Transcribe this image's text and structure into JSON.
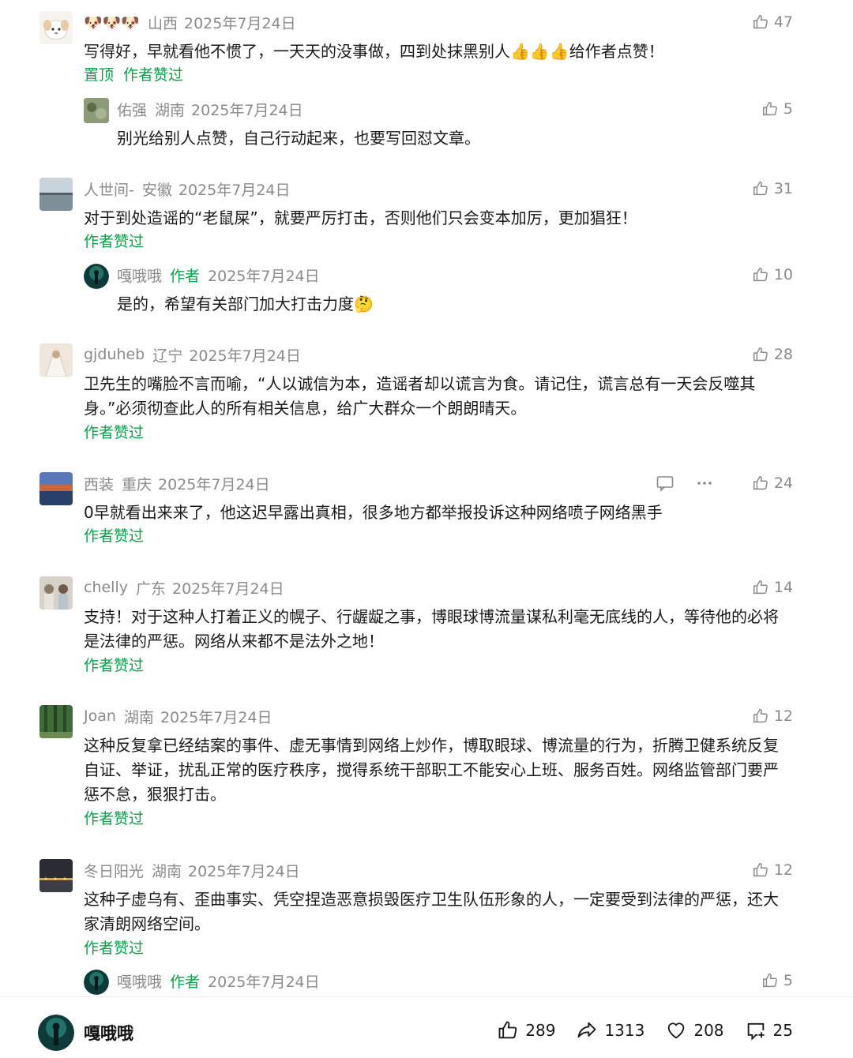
{
  "comments": [
    {
      "nick": "🐶🐶🐶",
      "region": "山西",
      "date": "2025年7月24日",
      "likes": "47",
      "text": "写得好，早就看他不惯了，一天天的没事做，四到处抹黑别人👍👍👍给作者点赞！",
      "tag_top": "置顶",
      "tag_liked": "作者赞过",
      "reply": {
        "nick": "佑强",
        "region": "湖南",
        "date": "2025年7月24日",
        "likes": "5",
        "text": "别光给别人点赞，自己行动起来，也要写回怼文章。"
      }
    },
    {
      "nick": "人世间-",
      "region": "安徽",
      "date": "2025年7月24日",
      "likes": "31",
      "text": "对于到处造谣的“老鼠屎”，就要严厉打击，否则他们只会变本加厉，更加猖狂！",
      "tag_liked": "作者赞过",
      "reply": {
        "nick": "嘎哦哦",
        "author_tag": "作者",
        "date": "2025年7月24日",
        "likes": "10",
        "text": "是的，希望有关部门加大打击力度🤔"
      }
    },
    {
      "nick": "gjduheb",
      "region": "辽宁",
      "date": "2025年7月24日",
      "likes": "28",
      "text": "卫先生的嘴脸不言而喻，“人以诚信为本，造谣者却以谎言为食。请记住，谎言总有一天会反噬其身。”必须彻查此人的所有相关信息，给广大群众一个朗朗晴天。",
      "tag_liked": "作者赞过"
    },
    {
      "nick": "西装",
      "region": "重庆",
      "date": "2025年7月24日",
      "likes": "24",
      "text": "0早就看出来来了，他这迟早露出真相，很多地方都举报投诉这种网络喷子网络黑手",
      "tag_liked": "作者赞过"
    },
    {
      "nick": "chelly",
      "region": "广东",
      "date": "2025年7月24日",
      "likes": "14",
      "text": "支持！对于这种人打着正义的幌子、行龌龊之事，博眼球博流量谋私利毫无底线的人，等待他的必将是法律的严惩。网络从来都不是法外之地！",
      "tag_liked": "作者赞过"
    },
    {
      "nick": "Joan",
      "region": "湖南",
      "date": "2025年7月24日",
      "likes": "12",
      "text": "这种反复拿已经结案的事件、虚无事情到网络上炒作，博取眼球、博流量的行为，折腾卫健系统反复自证、举证，扰乱正常的医疗秩序，搅得系统干部职工不能安心上班、服务百姓。网络监管部门要严惩不怠，狠狠打击。",
      "tag_liked": "作者赞过"
    },
    {
      "nick": "冬日阳光",
      "region": "湖南",
      "date": "2025年7月24日",
      "likes": "12",
      "text": "这种子虚乌有、歪曲事实、凭空捏造恶意损毁医疗卫生队伍形象的人，一定要受到法律的严惩，还大家清朗网络空间。",
      "tag_liked": "作者赞过",
      "reply": {
        "nick": "嘎哦哦",
        "author_tag": "作者",
        "date": "2025年7月24日",
        "likes": "5"
      }
    }
  ],
  "bottom": {
    "name": "嘎哦哦",
    "like_count": "289",
    "share_count": "1313",
    "fav_count": "208",
    "comment_count": "25"
  },
  "colors": {
    "accent_green": "#07a14a",
    "meta_gray": "#8a8a8a"
  },
  "icons": [
    "thumb-up-icon",
    "comment-bubble-icon",
    "more-dots-icon",
    "share-icon",
    "heart-icon",
    "comment-plus-icon"
  ]
}
